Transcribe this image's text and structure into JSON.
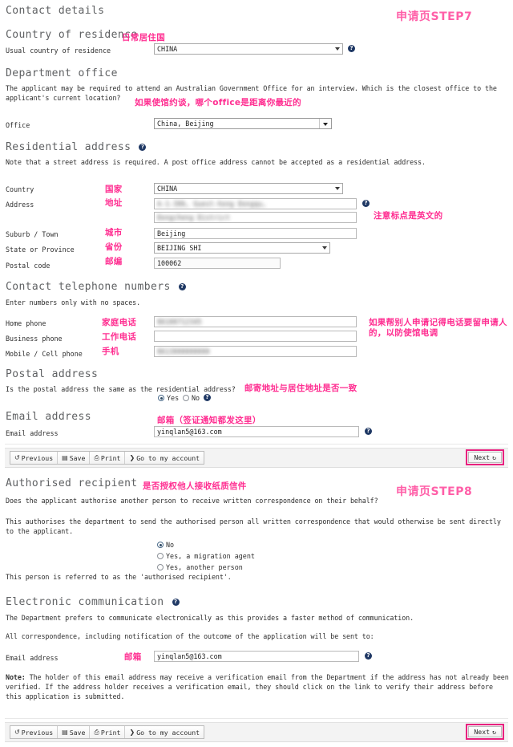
{
  "annotations": {
    "step7": "申请页STEP7",
    "step8": "申请页STEP8",
    "country_of_residence": "日常居住国",
    "office_hint": "如果使馆约谈，哪个office是距离你最近的",
    "country": "国家",
    "address": "地址",
    "punctuation_hint": "注意标点是英文的",
    "suburb": "城市",
    "state": "省份",
    "postal_code": "邮编",
    "home_phone": "家庭电话",
    "business_phone": "工作电话",
    "mobile_phone": "手机",
    "phone_hint": "如果帮别人申请记得电话要留申请人的，以防使馆电调",
    "postal_same_hint": "邮寄地址与居住地址是否一致",
    "email_hint": "邮箱（签证通知都发这里）",
    "authorised_hint": "是否授权他人接收纸质信件",
    "email_label": "邮箱"
  },
  "contact_details": {
    "heading": "Contact details"
  },
  "country_of_residence": {
    "heading": "Country of residence",
    "label": "Usual country of residence",
    "value": "CHINA"
  },
  "department_office": {
    "heading": "Department office",
    "paragraph": "The applicant may be required to attend an Australian Government Office for an interview. Which is the closest office to the applicant's current location?",
    "label": "Office",
    "value": "China, Beijing"
  },
  "residential_address": {
    "heading": "Residential address",
    "note": "Note that a street address is required. A post office address cannot be accepted as a residential address.",
    "country_label": "Country",
    "country_value": "CHINA",
    "address_label": "Address",
    "address_line1": "A-1-306, Guest-hong Dongqu,",
    "address_line2": "Dongcheng District",
    "suburb_label": "Suburb / Town",
    "suburb_value": "Beijing",
    "state_label": "State or Province",
    "state_value": "BEIJING SHI",
    "postal_label": "Postal code",
    "postal_value": "100062"
  },
  "telephone": {
    "heading": "Contact telephone numbers",
    "note": "Enter numbers only with no spaces.",
    "home_label": "Home phone",
    "home_value": "86100712345",
    "business_label": "Business phone",
    "business_value": "",
    "mobile_label": "Mobile / Cell phone",
    "mobile_value": "8613000000000"
  },
  "postal_address": {
    "heading": "Postal address",
    "question": "Is the postal address the same as the residential address?",
    "yes_label": "Yes",
    "no_label": "No",
    "selected": "Yes"
  },
  "email_section": {
    "heading": "Email address",
    "label": "Email address",
    "value": "yinqlan5@163.com"
  },
  "toolbar": {
    "previous": "Previous",
    "save": "Save",
    "print": "Print",
    "account": "Go to my account",
    "next": "Next",
    "previous_icon": "↺",
    "save_icon": "▤",
    "print_icon": "⎙",
    "account_icon": "❯",
    "next_icon": "↻"
  },
  "authorised_recipient": {
    "heading": "Authorised recipient",
    "question": "Does the applicant authorise another person to receive written correspondence on their behalf?",
    "paragraph": "This authorises the department to send the authorised person all written correspondence that would otherwise be sent directly to the applicant.",
    "options": [
      {
        "label": "No",
        "selected": true
      },
      {
        "label": "Yes, a migration agent",
        "selected": false
      },
      {
        "label": "Yes, another person",
        "selected": false
      }
    ],
    "footer": "This person is referred to as the 'authorised recipient'."
  },
  "electronic_communication": {
    "heading": "Electronic communication",
    "paragraph1": "The Department prefers to communicate electronically as this provides a faster method of communication.",
    "paragraph2": "All correspondence, including notification of the outcome of the application will be sent to:",
    "email_label": "Email address",
    "email_value": "yinqlan5@163.com",
    "note_prefix": "Note:",
    "note_body": " The holder of this email address may receive a verification email from the Department if the address has not already been verified. If the address holder receives a verification email, they should click on the link to verify their address before this application is submitted."
  },
  "colors": {
    "accent_pink": "#ff2e91",
    "highlight_border": "#e8217f",
    "help_icon": "#1f3864",
    "heading_grey": "#5f6163"
  },
  "icons": {
    "help": "?"
  }
}
